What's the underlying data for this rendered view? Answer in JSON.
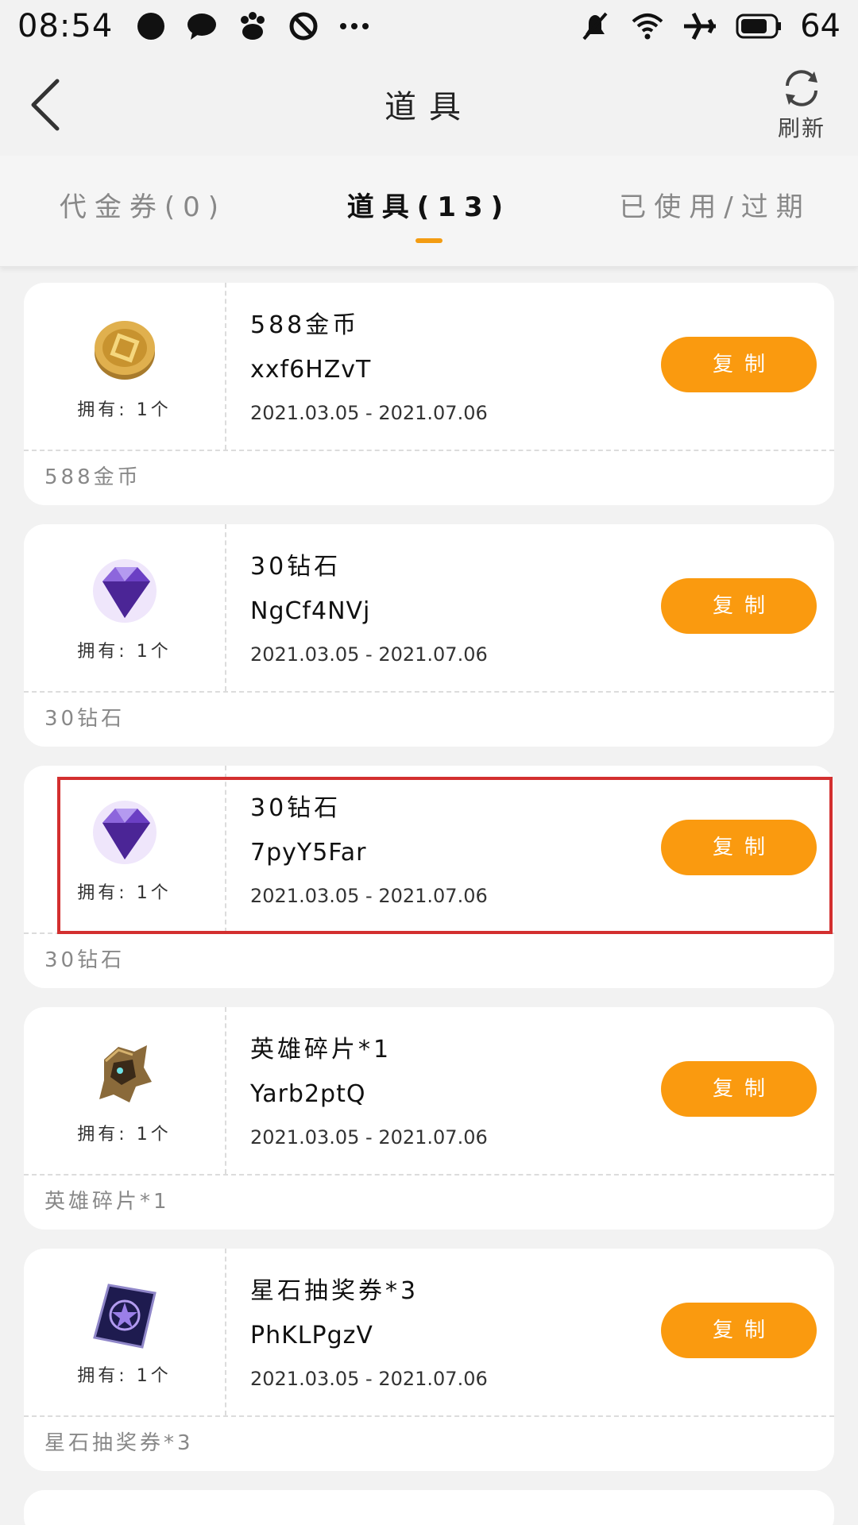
{
  "status_bar": {
    "time": "08:54",
    "battery": "64",
    "icons_left": [
      "chat-bubble-icon",
      "message-icon",
      "baidu-paw-icon",
      "blocked-icon",
      "more-dots-icon"
    ],
    "icons_right": [
      "mute-icon",
      "wifi-icon",
      "airplane-icon",
      "battery-icon"
    ]
  },
  "header": {
    "title": "道具",
    "refresh_label": "刷新"
  },
  "tabs": [
    {
      "label": "代金券(0)",
      "active": false
    },
    {
      "label": "道具(13)",
      "active": true
    },
    {
      "label": "已使用/过期",
      "active": false
    }
  ],
  "items": [
    {
      "name": "588金币",
      "code": "xxf6HZvT",
      "date": "2021.03.05 - 2021.07.06",
      "owned": "拥有: 1个",
      "button": "复制",
      "footer": "588金币",
      "icon": "gold-coin-icon"
    },
    {
      "name": "30钻石",
      "code": "NgCf4NVj",
      "date": "2021.03.05 - 2021.07.06",
      "owned": "拥有: 1个",
      "button": "复制",
      "footer": "30钻石",
      "icon": "diamond-icon"
    },
    {
      "name": "30钻石",
      "code": "7pyY5Far",
      "date": "2021.03.05 - 2021.07.06",
      "owned": "拥有: 1个",
      "button": "复制",
      "footer": "30钻石",
      "icon": "diamond-icon"
    },
    {
      "name": "英雄碎片*1",
      "code": "Yarb2ptQ",
      "date": "2021.03.05 - 2021.07.06",
      "owned": "拥有: 1个",
      "button": "复制",
      "footer": "英雄碎片*1",
      "icon": "hero-fragment-icon"
    },
    {
      "name": "星石抽奖券*3",
      "code": "PhKLPgzV",
      "date": "2021.03.05 - 2021.07.06",
      "owned": "拥有: 1个",
      "button": "复制",
      "footer": "星石抽奖券*3",
      "icon": "star-ticket-icon"
    }
  ],
  "colors": {
    "accent": "#fa9a0f",
    "highlight": "#d32f2f",
    "tab_indicator": "#f39c12"
  }
}
